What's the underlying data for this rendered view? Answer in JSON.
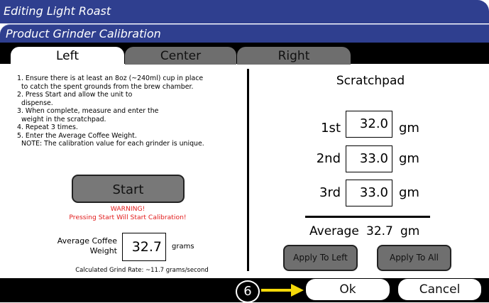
{
  "header": {
    "title": "Editing Light Roast",
    "subtitle": "Product Grinder Calibration"
  },
  "tabs": [
    {
      "label": "Left"
    },
    {
      "label": "Center"
    },
    {
      "label": "Right"
    }
  ],
  "instructions": [
    "1. Ensure there is at least an 8oz (~240ml) cup in place",
    "to catch the spent grounds from the brew chamber.",
    "2. Press Start and allow the unit to",
    "dispense.",
    "3. When complete, measure and enter the",
    "weight in the scratchpad.",
    "4. Repeat 3 times.",
    "5. Enter the Average Coffee Weight.",
    "NOTE:  The calibration value for each grinder is unique."
  ],
  "start_label": "Start",
  "warning": {
    "title": "WARNING!",
    "message": "Pressing Start Will Start Calibration!"
  },
  "average": {
    "label_line1": "Average Coffee",
    "label_line2": "Weight",
    "value": "32.7",
    "unit": "grams"
  },
  "grind_rate": "Calculated Grind Rate: ~11.7 grams/second",
  "scratchpad": {
    "title": "Scratchpad",
    "entries": [
      {
        "label": "1st",
        "value": "32.0",
        "unit": "gm"
      },
      {
        "label": "2nd",
        "value": "33.0",
        "unit": "gm"
      },
      {
        "label": "3rd",
        "value": "33.0",
        "unit": "gm"
      }
    ],
    "average_label": "Average",
    "average_value": "32.7",
    "average_unit": "gm",
    "apply_left": "Apply To Left",
    "apply_all": "Apply To All"
  },
  "footer": {
    "ok": "Ok",
    "cancel": "Cancel",
    "step": "6"
  },
  "colors": {
    "header": "#2f3f8f",
    "warning": "#e21b1b",
    "arrow": "#f5d90a"
  },
  "icons": {
    "arrow": "arrow-right-icon"
  }
}
